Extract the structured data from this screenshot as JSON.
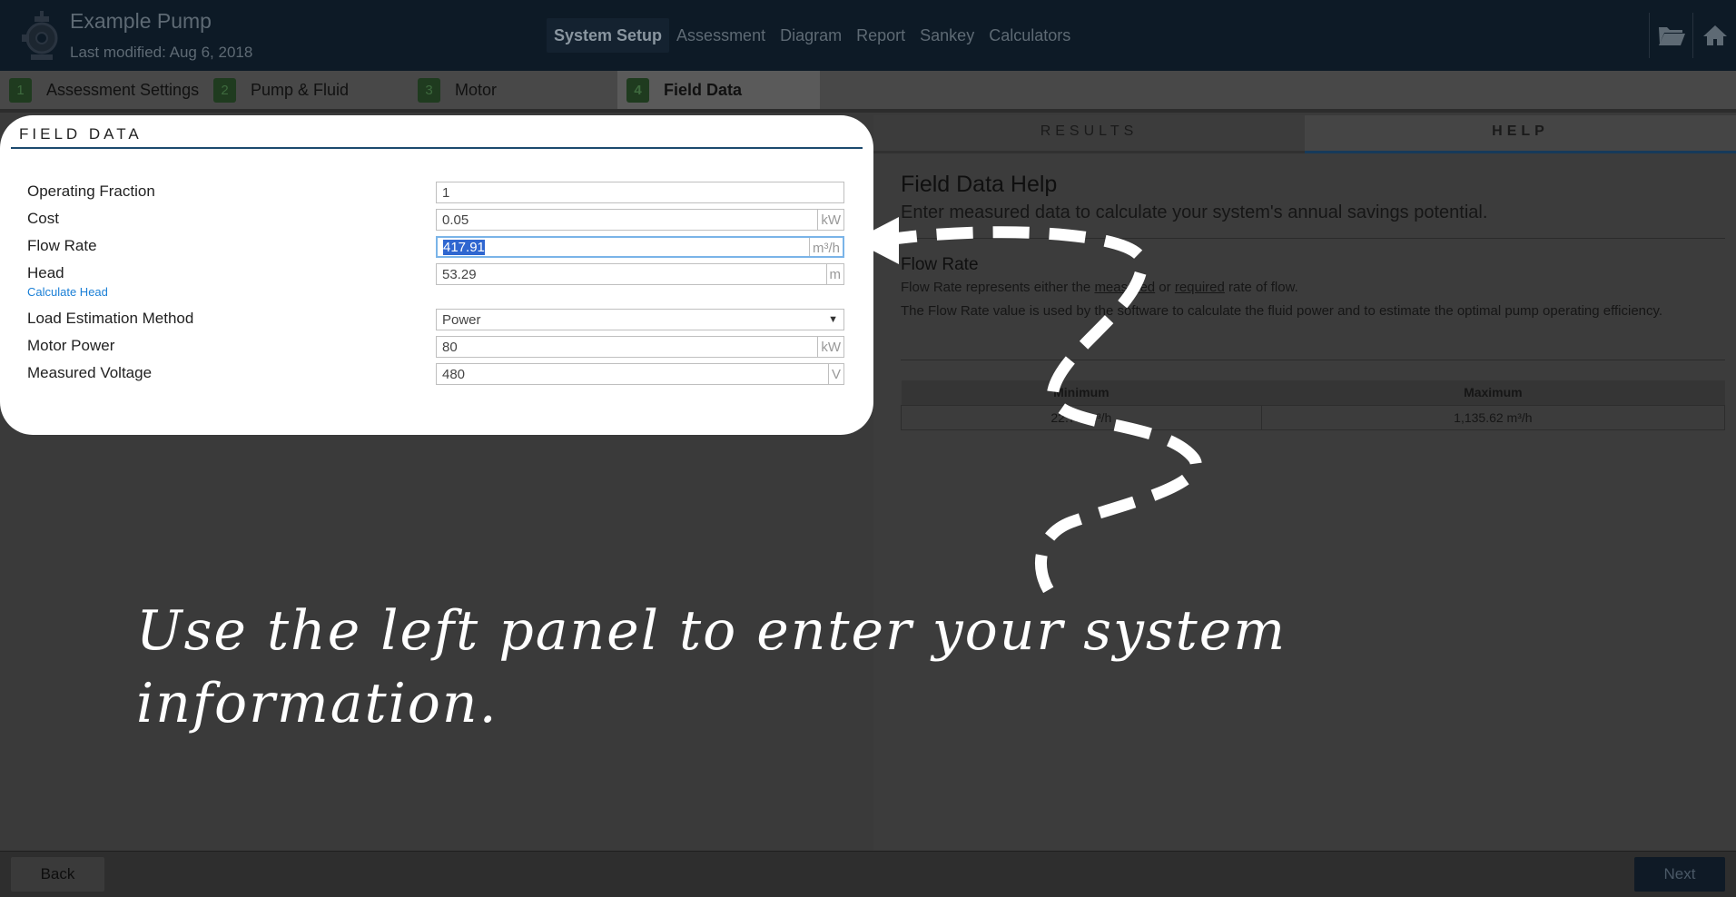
{
  "header": {
    "title": "Example Pump",
    "last_modified": "Last modified: Aug 6, 2018",
    "logo_icon": "pump-icon",
    "nav": [
      "System Setup",
      "Assessment",
      "Diagram",
      "Report",
      "Sankey",
      "Calculators"
    ],
    "active_nav": "System Setup",
    "tools": [
      "folder-open-icon",
      "home-icon"
    ]
  },
  "steps": [
    {
      "num": "1",
      "label": "Assessment Settings"
    },
    {
      "num": "2",
      "label": "Pump & Fluid"
    },
    {
      "num": "3",
      "label": "Motor"
    },
    {
      "num": "4",
      "label": "Field Data"
    }
  ],
  "active_step": "Field Data",
  "form": {
    "title": "FIELD DATA",
    "fields": {
      "operating_fraction": {
        "label": "Operating Fraction",
        "value": "1"
      },
      "cost": {
        "label": "Cost",
        "value": "0.05",
        "unit": "kW"
      },
      "flow_rate": {
        "label": "Flow Rate",
        "value": "417.91",
        "unit": "m³/h"
      },
      "head": {
        "label": "Head",
        "value": "53.29",
        "unit": "m"
      },
      "load_estimation": {
        "label": "Load Estimation Method",
        "value": "Power"
      },
      "motor_power": {
        "label": "Motor Power",
        "value": "80",
        "unit": "kW"
      },
      "measured_voltage": {
        "label": "Measured Voltage",
        "value": "480",
        "unit": "V"
      }
    },
    "calculate_head_link": "Calculate Head"
  },
  "right_panel": {
    "tabs": [
      "RESULTS",
      "HELP"
    ],
    "active_tab": "HELP",
    "help": {
      "title": "Field Data Help",
      "intro": "Enter measured data to calculate your system's annual savings potential.",
      "subtitle": "Flow Rate",
      "p1_before": "Flow Rate represents either the ",
      "p1_link1": "measured",
      "p1_mid": " or ",
      "p1_link2": "required",
      "p1_after": " rate of flow.",
      "p2": "The Flow Rate value is used by the software to calculate the fluid power and to estimate the optimal pump operating efficiency.",
      "table": {
        "headers": [
          "Minimum",
          "Maximum"
        ],
        "row": [
          "22.71 m³/h",
          "1,135.62 m³/h"
        ]
      }
    }
  },
  "tour": {
    "caption": "Use the left panel to enter your system information."
  },
  "footer": {
    "back": "Back",
    "next": "Next"
  },
  "colors": {
    "header_bg": "#0d1a26",
    "overlay_bg": "#3a3a3a",
    "link_blue": "#1a7fd6",
    "selection_blue": "#2f66d0",
    "step_badge": "#1f3b1f"
  }
}
